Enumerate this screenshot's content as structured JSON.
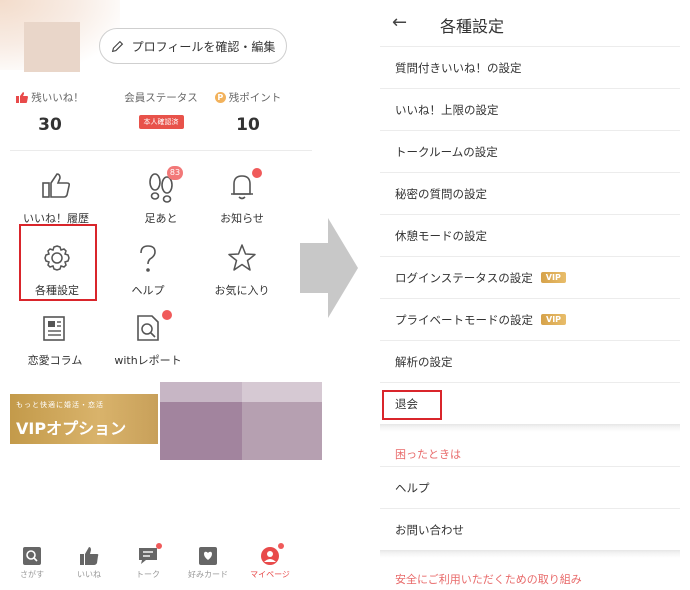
{
  "left": {
    "profile_button_label": "プロフィールを確認・編集",
    "stats": [
      {
        "label": "残いいね！",
        "value": "30"
      },
      {
        "label": "会員ステータス",
        "badge": "本人確認済"
      },
      {
        "label": "残ポイント",
        "value": "10"
      }
    ],
    "grid": [
      {
        "label": "いいね！履歴",
        "icon": "thumbs-up-icon"
      },
      {
        "label": "足あと",
        "icon": "footprints-icon",
        "badge": "83"
      },
      {
        "label": "お知らせ",
        "icon": "bell-icon"
      },
      {
        "label": "各種設定",
        "icon": "gear-icon"
      },
      {
        "label": "ヘルプ",
        "icon": "question-heart-icon"
      },
      {
        "label": "お気に入り",
        "icon": "star-icon"
      },
      {
        "label": "恋愛コラム",
        "icon": "newspaper-icon"
      },
      {
        "label": "withレポート",
        "icon": "report-icon"
      }
    ],
    "banner": {
      "sub": "もっと快適に婚活・恋活",
      "main": "VIPオプション"
    },
    "tabs": [
      {
        "label": "さがす",
        "icon": "search-icon"
      },
      {
        "label": "いいね",
        "icon": "thumbs-up-icon"
      },
      {
        "label": "トーク",
        "icon": "chat-icon"
      },
      {
        "label": "好みカード",
        "icon": "card-icon"
      },
      {
        "label": "マイページ",
        "icon": "mypage-icon"
      }
    ],
    "accent_color": "#e84a4a"
  },
  "right": {
    "back_icon": "←",
    "title": "各種設定",
    "menu": [
      {
        "label": "質問付きいいね！の設定"
      },
      {
        "label": "いいね！上限の設定"
      },
      {
        "label": "トークルームの設定"
      },
      {
        "label": "秘密の質問の設定"
      },
      {
        "label": "休憩モードの設定"
      },
      {
        "label": "ログインステータスの設定",
        "vip": "VIP"
      },
      {
        "label": "プライベートモードの設定",
        "vip": "VIP"
      },
      {
        "label": "解析の設定"
      },
      {
        "label": "退会"
      }
    ],
    "section_label": "困ったときは",
    "section_items": [
      {
        "label": "ヘルプ"
      },
      {
        "label": "お問い合わせ"
      }
    ],
    "footer_link": "安全にご利用いただくための取り組み"
  }
}
